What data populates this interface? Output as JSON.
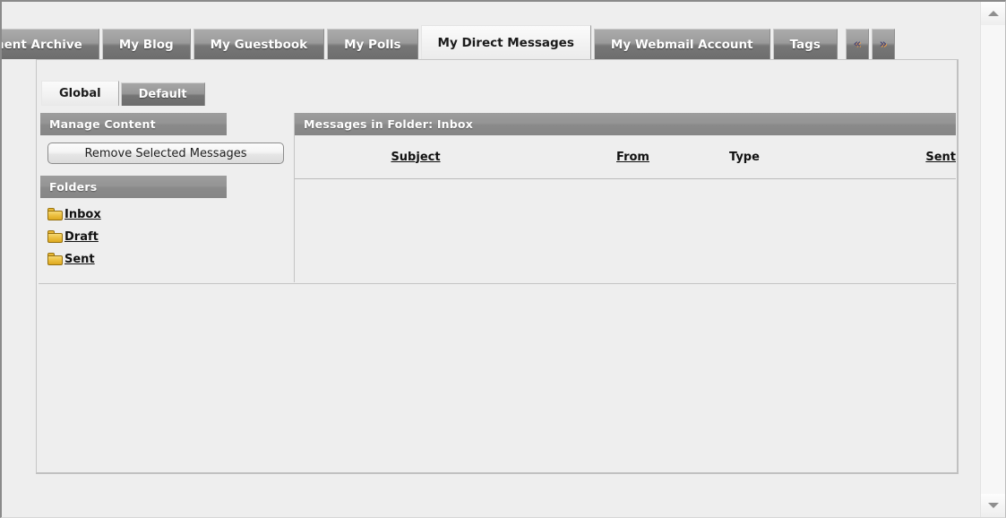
{
  "tabs": {
    "items": [
      {
        "label": "nent Archive",
        "active": false,
        "kind": "tab"
      },
      {
        "label": "My Blog",
        "active": false,
        "kind": "tab"
      },
      {
        "label": "My Guestbook",
        "active": false,
        "kind": "tab"
      },
      {
        "label": "My Polls",
        "active": false,
        "kind": "tab"
      },
      {
        "label": "My Direct Messages",
        "active": true,
        "kind": "tab"
      },
      {
        "label": "My Webmail Account",
        "active": false,
        "kind": "tab"
      },
      {
        "label": "Tags",
        "active": false,
        "kind": "tab"
      },
      {
        "label": "«",
        "active": false,
        "kind": "arrow"
      },
      {
        "label": "»",
        "active": false,
        "kind": "arrow"
      }
    ]
  },
  "subtabs": {
    "items": [
      {
        "label": "Global",
        "active": true
      },
      {
        "label": "Default",
        "active": false
      }
    ]
  },
  "left_panel": {
    "manage_header": "Manage Content",
    "remove_button": "Remove Selected Messages",
    "folders_header": "Folders",
    "folders": [
      {
        "label": "Inbox",
        "icon": "folder-icon"
      },
      {
        "label": "Draft",
        "icon": "folder-icon"
      },
      {
        "label": "Sent",
        "icon": "folder-icon"
      }
    ]
  },
  "messages_panel": {
    "header": "Messages in Folder: Inbox",
    "columns": [
      {
        "label": "Subject",
        "sortable": true
      },
      {
        "label": "From",
        "sortable": true
      },
      {
        "label": "Type",
        "sortable": false
      },
      {
        "label": "Sent",
        "sortable": true
      }
    ],
    "rows": []
  },
  "scrollbar": {
    "up_icon": "scroll-up-arrow-icon",
    "down_icon": "scroll-down-arrow-icon"
  },
  "colors": {
    "page_background": "#eeeeee",
    "header_bar": "#909090",
    "tab_inactive": "#8f8f8f",
    "tab_active": "#f3f3f3",
    "folder_icon": "#ecc143",
    "border": "#c4c4c4"
  }
}
